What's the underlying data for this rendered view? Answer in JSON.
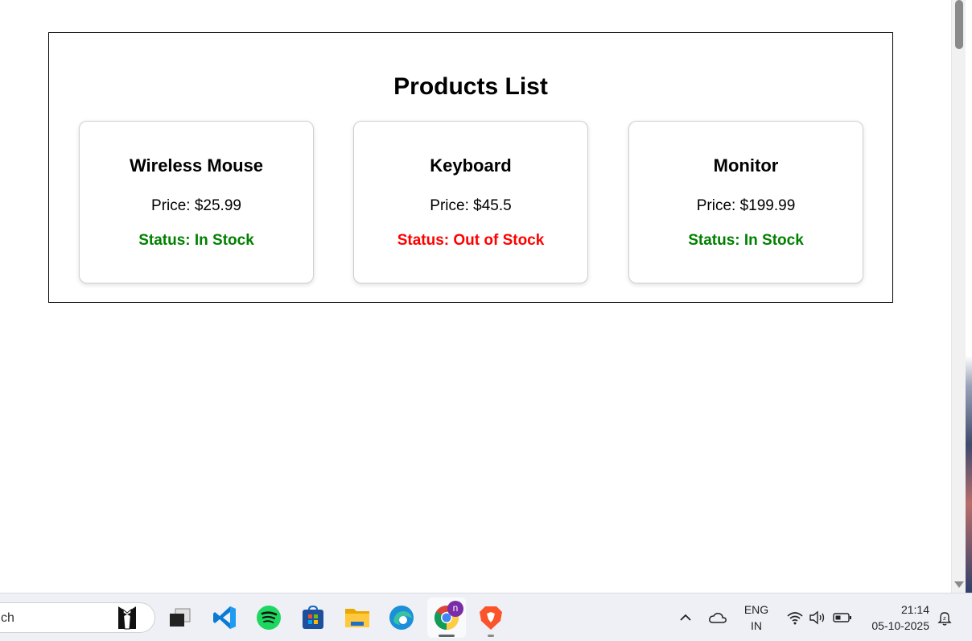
{
  "page": {
    "title": "Products List"
  },
  "products": [
    {
      "name": "Wireless Mouse",
      "price": "Price: $25.99",
      "status": "Status: In Stock",
      "status_color": "#008000"
    },
    {
      "name": "Keyboard",
      "price": "Price: $45.5",
      "status": "Status: Out of Stock",
      "status_color": "#ff0000"
    },
    {
      "name": "Monitor",
      "price": "Price: $199.99",
      "status": "Status: In Stock",
      "status_color": "#008000"
    }
  ],
  "taskbar": {
    "search_text": "ch",
    "apps": [
      "tuxedo-app-icon",
      "task-view-icon",
      "vscode-icon",
      "spotify-icon",
      "store-icon",
      "file-explorer-icon",
      "edge-icon",
      "chrome-icon",
      "brave-icon"
    ],
    "chrome_badge": "n",
    "tray": {
      "language": "ENG",
      "region": "IN",
      "time": "21:14",
      "date": "05-10-2025"
    }
  }
}
